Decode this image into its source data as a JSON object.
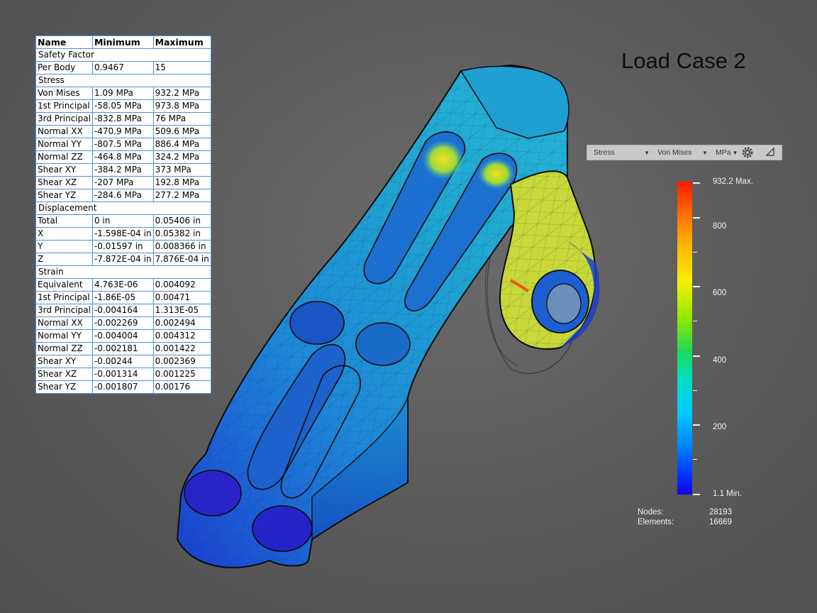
{
  "title": "Load Case 2",
  "table": {
    "headers": [
      "Name",
      "Minimum",
      "Maximum"
    ],
    "rows": [
      {
        "section": "Safety Factor"
      },
      {
        "name": "Per Body",
        "min": "0.9467",
        "max": "15"
      },
      {
        "section": "Stress"
      },
      {
        "name": "Von Mises",
        "min": "1.09 MPa",
        "max": "932.2 MPa"
      },
      {
        "name": "1st Principal",
        "min": "-58.05 MPa",
        "max": "973.8 MPa"
      },
      {
        "name": "3rd Principal",
        "min": "-832.8 MPa",
        "max": "76 MPa"
      },
      {
        "name": "Normal XX",
        "min": "-470.9 MPa",
        "max": "509.6 MPa"
      },
      {
        "name": "Normal YY",
        "min": "-807.5 MPa",
        "max": "886.4 MPa"
      },
      {
        "name": "Normal ZZ",
        "min": "-464.8 MPa",
        "max": "324.2 MPa"
      },
      {
        "name": "Shear XY",
        "min": "-384.2 MPa",
        "max": "373 MPa"
      },
      {
        "name": "Shear XZ",
        "min": "-207 MPa",
        "max": "192.8 MPa"
      },
      {
        "name": "Shear YZ",
        "min": "-284.6 MPa",
        "max": "277.2 MPa"
      },
      {
        "section": "Displacement"
      },
      {
        "name": "Total",
        "min": "0 in",
        "max": "0.05406 in"
      },
      {
        "name": "X",
        "min": "-1.598E-04 in",
        "max": "0.05382 in"
      },
      {
        "name": "Y",
        "min": "-0.01597 in",
        "max": "0.008366 in"
      },
      {
        "name": "Z",
        "min": "-7.872E-04 in",
        "max": "7.876E-04 in"
      },
      {
        "section": "Strain"
      },
      {
        "name": "Equivalent",
        "min": "4.763E-06",
        "max": "0.004092"
      },
      {
        "name": "1st Principal",
        "min": "-1.86E-05",
        "max": "0.00471"
      },
      {
        "name": "3rd Principal",
        "min": "-0.004164",
        "max": "1.313E-05"
      },
      {
        "name": "Normal XX",
        "min": "-0.002269",
        "max": "0.002494"
      },
      {
        "name": "Normal YY",
        "min": "-0.004004",
        "max": "0.004312"
      },
      {
        "name": "Normal ZZ",
        "min": "-0.002181",
        "max": "0.001422"
      },
      {
        "name": "Shear XY",
        "min": "-0.00244",
        "max": "0.002369"
      },
      {
        "name": "Shear XZ",
        "min": "-0.001314",
        "max": "0.001225"
      },
      {
        "name": "Shear YZ",
        "min": "-0.001807",
        "max": "0.00176"
      }
    ]
  },
  "toolbar": {
    "result_type": "Stress",
    "component": "Von Mises",
    "unit": "MPa",
    "settings_icon": "gear-icon",
    "collapse_icon": "triangle-icon"
  },
  "legend": {
    "max_label": "932.2 Max.",
    "min_label": "1.1 Min.",
    "tick_labels": [
      "800",
      "600",
      "400",
      "200"
    ],
    "scale_max": 932.2,
    "scale_min": 1.1
  },
  "mesh": {
    "nodes_label": "Nodes:",
    "nodes_value": "28193",
    "elements_label": "Elements:",
    "elements_value": "16669"
  }
}
